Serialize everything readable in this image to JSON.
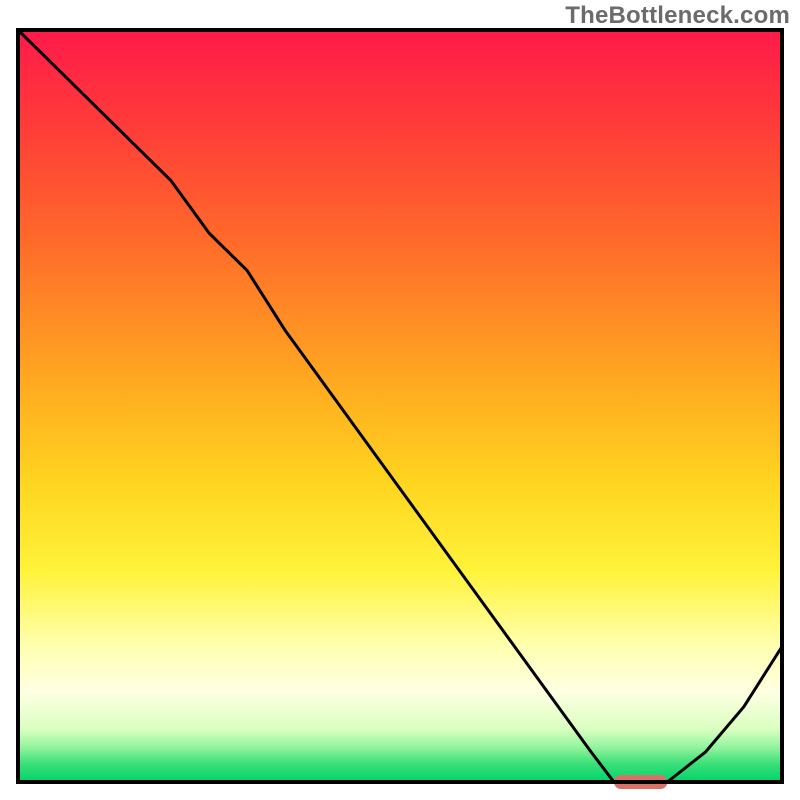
{
  "watermark": "TheBottleneck.com",
  "chart_data": {
    "type": "line",
    "title": "",
    "xlabel": "",
    "ylabel": "",
    "xlim": [
      0,
      100
    ],
    "ylim": [
      0,
      100
    ],
    "x": [
      0,
      5,
      10,
      15,
      20,
      25,
      30,
      35,
      40,
      45,
      50,
      55,
      60,
      65,
      70,
      75,
      78,
      80,
      85,
      90,
      95,
      100
    ],
    "values": [
      100,
      95,
      90,
      85,
      80,
      73,
      68,
      60,
      53,
      46,
      39,
      32,
      25,
      18,
      11,
      4,
      0,
      0,
      0,
      4,
      10,
      18
    ],
    "marker": {
      "x_start": 78,
      "x_end": 85,
      "y": 0,
      "color": "#d9716b"
    },
    "gradient_stops": [
      {
        "offset": 0.0,
        "color": "#ff1a4a"
      },
      {
        "offset": 0.12,
        "color": "#ff3a3a"
      },
      {
        "offset": 0.28,
        "color": "#ff6a2a"
      },
      {
        "offset": 0.45,
        "color": "#ffa321"
      },
      {
        "offset": 0.6,
        "color": "#ffd41f"
      },
      {
        "offset": 0.72,
        "color": "#fff33a"
      },
      {
        "offset": 0.82,
        "color": "#ffffb0"
      },
      {
        "offset": 0.88,
        "color": "#ffffe2"
      },
      {
        "offset": 0.93,
        "color": "#d9ffc0"
      },
      {
        "offset": 0.955,
        "color": "#8ff39b"
      },
      {
        "offset": 0.975,
        "color": "#3de07a"
      },
      {
        "offset": 1.0,
        "color": "#00d46a"
      }
    ],
    "frame_color": "#000000",
    "curve_color": "#000000",
    "curve_width": 3
  }
}
